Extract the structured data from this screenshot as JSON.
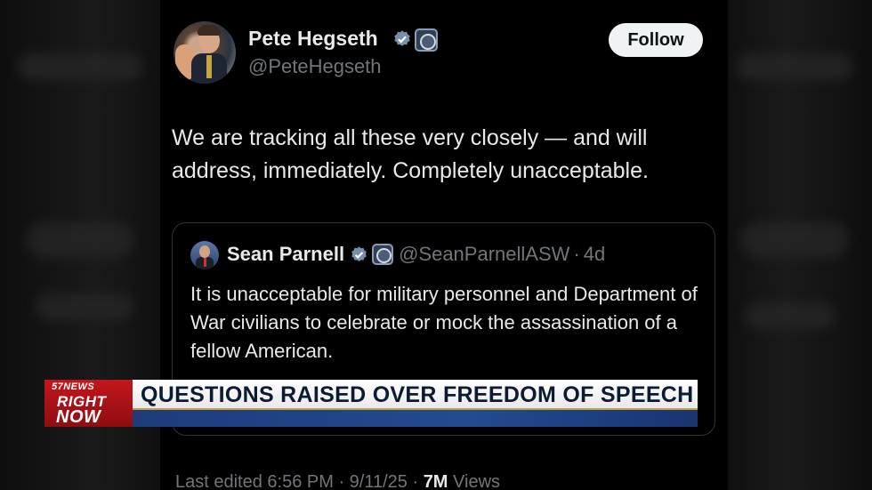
{
  "tweet": {
    "author_name": "Pete Hegseth",
    "author_handle": "@PeteHegseth",
    "follow_label": "Follow",
    "text": "We are tracking all these very closely — and will address, immediately. Completely unacceptable.",
    "quote": {
      "author_name": "Sean Parnell",
      "author_handle": "@SeanParnellASW",
      "separator": "·",
      "time": "4d",
      "text": "It is unacceptable for military personnel and Department of War civilians to celebrate or mock the assassination of a fellow American."
    },
    "footer": {
      "edited": "Last edited 6:56 PM · 9/11/25 ·",
      "views_count": "7M",
      "views_label": "Views"
    }
  },
  "news": {
    "logo_top": "57NEWS",
    "logo_right": "RIGHT",
    "logo_now": "NOW",
    "headline": "QUESTIONS RAISED OVER FREEDOM OF SPEECH"
  },
  "icons": {
    "verified": "verified-check-icon",
    "gov_badge": "government-seal-icon"
  },
  "colors": {
    "background": "#000000",
    "text_primary": "#e7e9ea",
    "text_secondary": "#71767b",
    "verified_blue": "#7a8ea8",
    "news_red": "#c4161c",
    "news_blue": "#234a90"
  }
}
